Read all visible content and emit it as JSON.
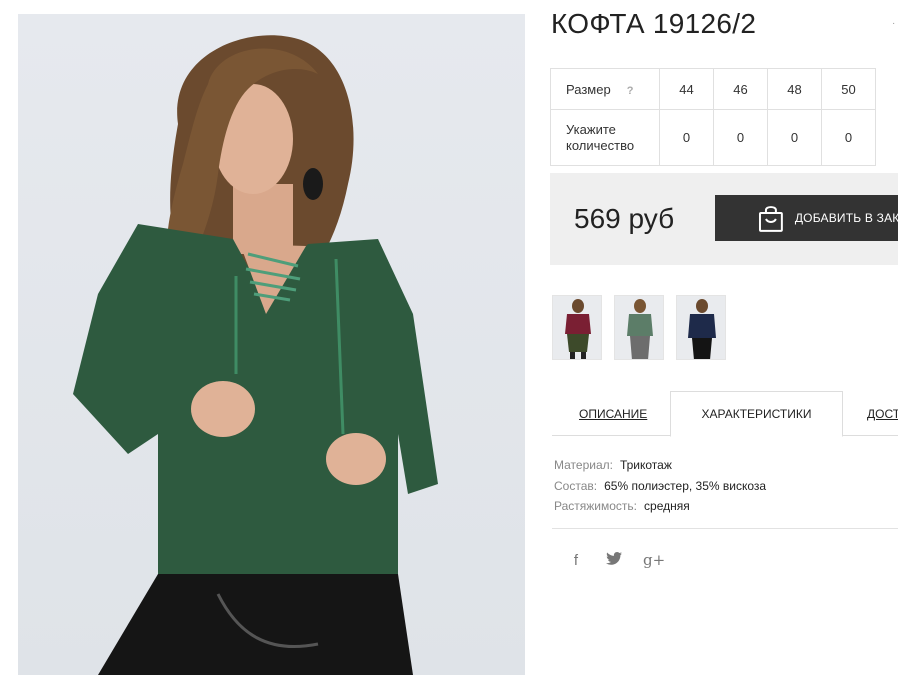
{
  "product": {
    "title": "КОФТА 19126/2",
    "corner_mark": "·"
  },
  "sizes": {
    "header_label": "Размер",
    "help_icon": "?",
    "values": [
      "44",
      "46",
      "48",
      "50"
    ],
    "qty_label": "Укажите количество",
    "quantities": [
      "0",
      "0",
      "0",
      "0"
    ]
  },
  "price": {
    "amount": "569 руб",
    "order_label": "ДОБАВИТЬ В ЗАКАЗ",
    "order_icon": "shopping-bag-icon"
  },
  "thumbnails": [
    {
      "color": "#7a1f33",
      "name": "burgundy"
    },
    {
      "color": "#2f5f45",
      "name": "green"
    },
    {
      "color": "#1e2a4a",
      "name": "navy"
    }
  ],
  "tabs": [
    {
      "label": "ОПИСАНИЕ",
      "active": false
    },
    {
      "label": "ХАРАКТЕРИСТИКИ",
      "active": true
    },
    {
      "label": "ДОСТАВКА",
      "active": false
    }
  ],
  "characteristics": [
    {
      "key": "Материал:",
      "value": "Трикотаж"
    },
    {
      "key": "Состав:",
      "value": "65% полиэстер, 35% вискоза"
    },
    {
      "key": "Растяжимость:",
      "value": "средняя"
    }
  ],
  "social": [
    {
      "icon": "facebook-icon",
      "glyph": "f"
    },
    {
      "icon": "twitter-icon",
      "glyph": "🐦"
    },
    {
      "icon": "google-plus-icon",
      "glyph": "g+"
    }
  ],
  "colors": {
    "sweater": "#2e5a3f",
    "order_button": "#333333",
    "price_bg": "#efefef"
  }
}
